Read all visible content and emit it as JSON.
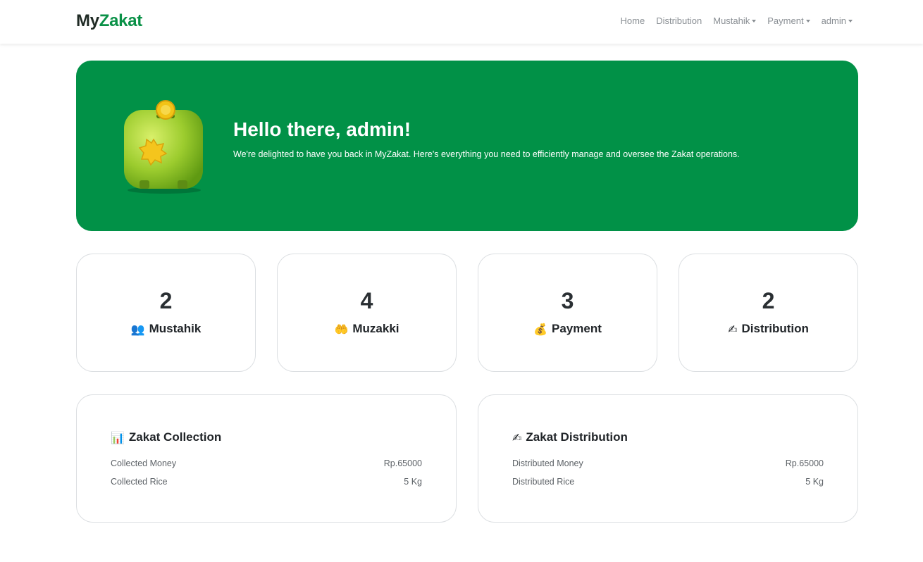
{
  "brand": {
    "part1": "My",
    "part2": "Zakat"
  },
  "nav": {
    "home": "Home",
    "distribution": "Distribution",
    "mustahik": "Mustahik",
    "payment": "Payment",
    "user": "admin"
  },
  "hero": {
    "title": "Hello there, admin!",
    "subtitle": "We're delighted to have you back in MyZakat. Here's everything you need to efficiently manage and oversee the Zakat operations.",
    "image_icon": "zakat-box-icon"
  },
  "stats": [
    {
      "value": "2",
      "label": "Mustahik",
      "icon": "👥",
      "icon_name": "people-icon"
    },
    {
      "value": "4",
      "label": "Muzakki",
      "icon": "🤲",
      "icon_name": "open-hands-icon"
    },
    {
      "value": "3",
      "label": "Payment",
      "icon": "💰",
      "icon_name": "money-bag-icon"
    },
    {
      "value": "2",
      "label": "Distribution",
      "icon": "✍",
      "icon_name": "writing-hand-icon"
    }
  ],
  "collection": {
    "icon": "📊",
    "title": "Zakat Collection",
    "money_label": "Collected Money",
    "money_value": "Rp.65000",
    "rice_label": "Collected Rice",
    "rice_value": "5 Kg"
  },
  "distribution": {
    "icon": "✍",
    "title": "Zakat Distribution",
    "money_label": "Distributed Money",
    "money_value": "Rp.65000",
    "rice_label": "Distributed Rice",
    "rice_value": "5 Kg"
  },
  "colors": {
    "primary": "#019147",
    "brand_dark": "#1f2a24",
    "brand_green": "#0a9147"
  }
}
